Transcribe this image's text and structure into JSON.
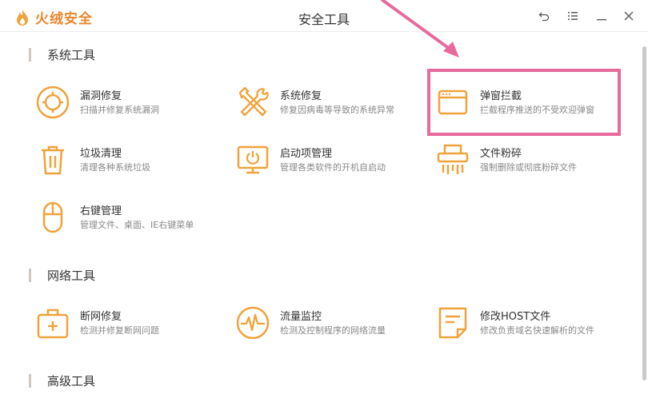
{
  "app": {
    "name": "火绒安全",
    "window_title": "安全工具"
  },
  "window_controls": [
    {
      "icon": "back-icon"
    },
    {
      "icon": "menu-icon"
    },
    {
      "icon": "minimize-icon"
    },
    {
      "icon": "close-icon"
    }
  ],
  "sections": {
    "system": {
      "title": "系统工具",
      "tools": [
        {
          "name": "漏洞修复",
          "desc": "扫描并修复系统漏洞",
          "icon": "vulnerability-fix-icon"
        },
        {
          "name": "系统修复",
          "desc": "修复因病毒等导致的系统异常",
          "icon": "wrench-screwdriver-icon"
        },
        {
          "name": "弹窗拦截",
          "desc": "拦截程序推送的不受欢迎弹窗",
          "icon": "popup-window-icon"
        },
        {
          "name": "垃圾清理",
          "desc": "清理各种系统垃圾",
          "icon": "trash-icon"
        },
        {
          "name": "启动项管理",
          "desc": "管理各类软件的开机自启动",
          "icon": "monitor-power-icon"
        },
        {
          "name": "文件粉碎",
          "desc": "强制删除或彻底粉碎文件",
          "icon": "shredder-icon"
        },
        {
          "name": "右键管理",
          "desc": "管理文件、桌面、IE右键菜单",
          "icon": "mouse-icon"
        }
      ]
    },
    "network": {
      "title": "网络工具",
      "tools": [
        {
          "name": "断网修复",
          "desc": "检测并修复断网问题",
          "icon": "first-aid-kit-icon"
        },
        {
          "name": "流量监控",
          "desc": "检测及控制程序的网络流量",
          "icon": "traffic-pulse-icon"
        },
        {
          "name": "修改HOST文件",
          "desc": "修改负责域名快速解析的文件",
          "icon": "host-file-icon"
        }
      ]
    },
    "advanced": {
      "title": "高级工具"
    }
  },
  "colors": {
    "accent": "#f0a33a",
    "brand": "#e8862a",
    "highlight": "#e66b9c"
  }
}
